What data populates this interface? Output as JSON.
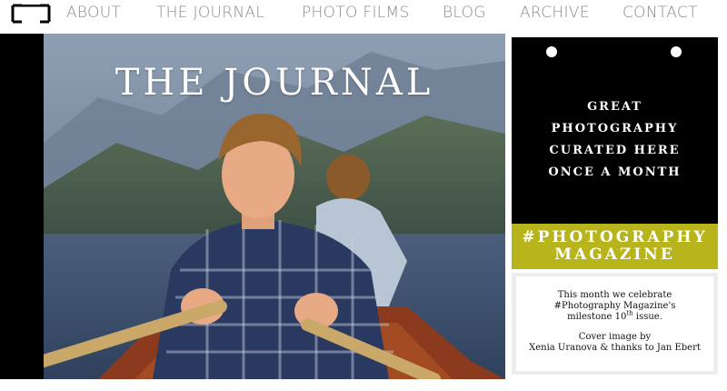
{
  "nav": {
    "items": [
      {
        "label": "ABOUT"
      },
      {
        "label": "THE JOURNAL"
      },
      {
        "label": "PHOTO FILMS"
      },
      {
        "label": "BLOG"
      },
      {
        "label": "ARCHIVE"
      },
      {
        "label": "CONTACT"
      }
    ]
  },
  "hero": {
    "title": "THE JOURNAL"
  },
  "sidebar": {
    "tagline": [
      "GREAT",
      "PHOTOGRAPHY",
      "CURATED HERE",
      "ONCE A MONTH"
    ],
    "hashtag": [
      "#PHOTOGRAPHY",
      "MAGAZINE"
    ],
    "note": {
      "line1": "This month we celebrate",
      "line2": "#Photography Magazine's",
      "line3_pre": "milestone 10",
      "line3_sup": "th",
      "line3_post": " issue.",
      "line4": "Cover image by",
      "line5": "Xenia Uranova & thanks to Jan Ebert"
    }
  },
  "colors": {
    "nav_text": "#8a8a8a",
    "black_card": "#000000",
    "yellow_card": "#b7b51b",
    "note_bg": "#ffffff"
  }
}
